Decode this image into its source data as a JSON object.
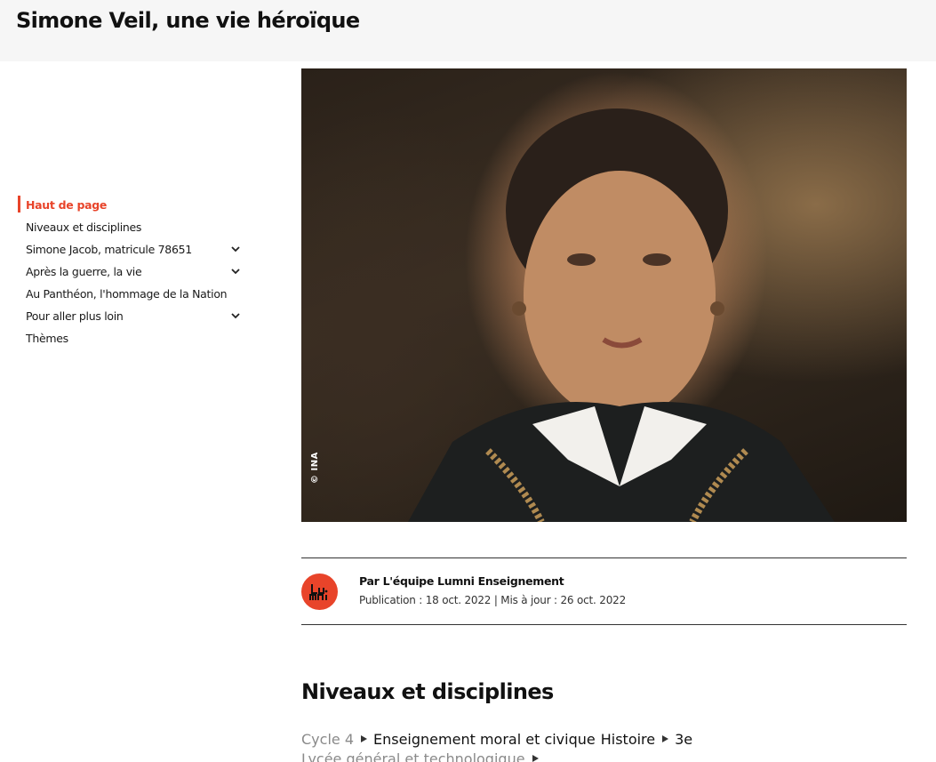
{
  "header": {
    "title": "Simone Veil, une vie héroïque"
  },
  "sidebar": {
    "items": [
      {
        "label": "Haut de page",
        "active": true,
        "expandable": false
      },
      {
        "label": "Niveaux et disciplines",
        "active": false,
        "expandable": false
      },
      {
        "label": "Simone Jacob, matricule 78651",
        "active": false,
        "expandable": true
      },
      {
        "label": "Après la guerre, la vie",
        "active": false,
        "expandable": true
      },
      {
        "label": "Au Panthéon, l'hommage de la Nation",
        "active": false,
        "expandable": false
      },
      {
        "label": "Pour aller plus loin",
        "active": false,
        "expandable": true
      },
      {
        "label": "Thèmes",
        "active": false,
        "expandable": false
      }
    ]
  },
  "hero": {
    "credit": "© INA"
  },
  "author": {
    "logo_text": "Lumni",
    "by_line": "Par L'équipe Lumni Enseignement",
    "dates": "Publication : 18 oct. 2022 | Mis à jour : 26 oct. 2022"
  },
  "levels_section": {
    "title": "Niveaux et disciplines",
    "row1": {
      "cycle": "Cycle 4",
      "discipline_1": "Enseignement moral et civique",
      "discipline_2": "Histoire",
      "level": "3e"
    },
    "row2": {
      "cycle": "Lycée général et technologique"
    }
  },
  "colors": {
    "accent": "#e8442a",
    "header_bg": "#f6f6f6",
    "muted": "#8a8a8a"
  }
}
